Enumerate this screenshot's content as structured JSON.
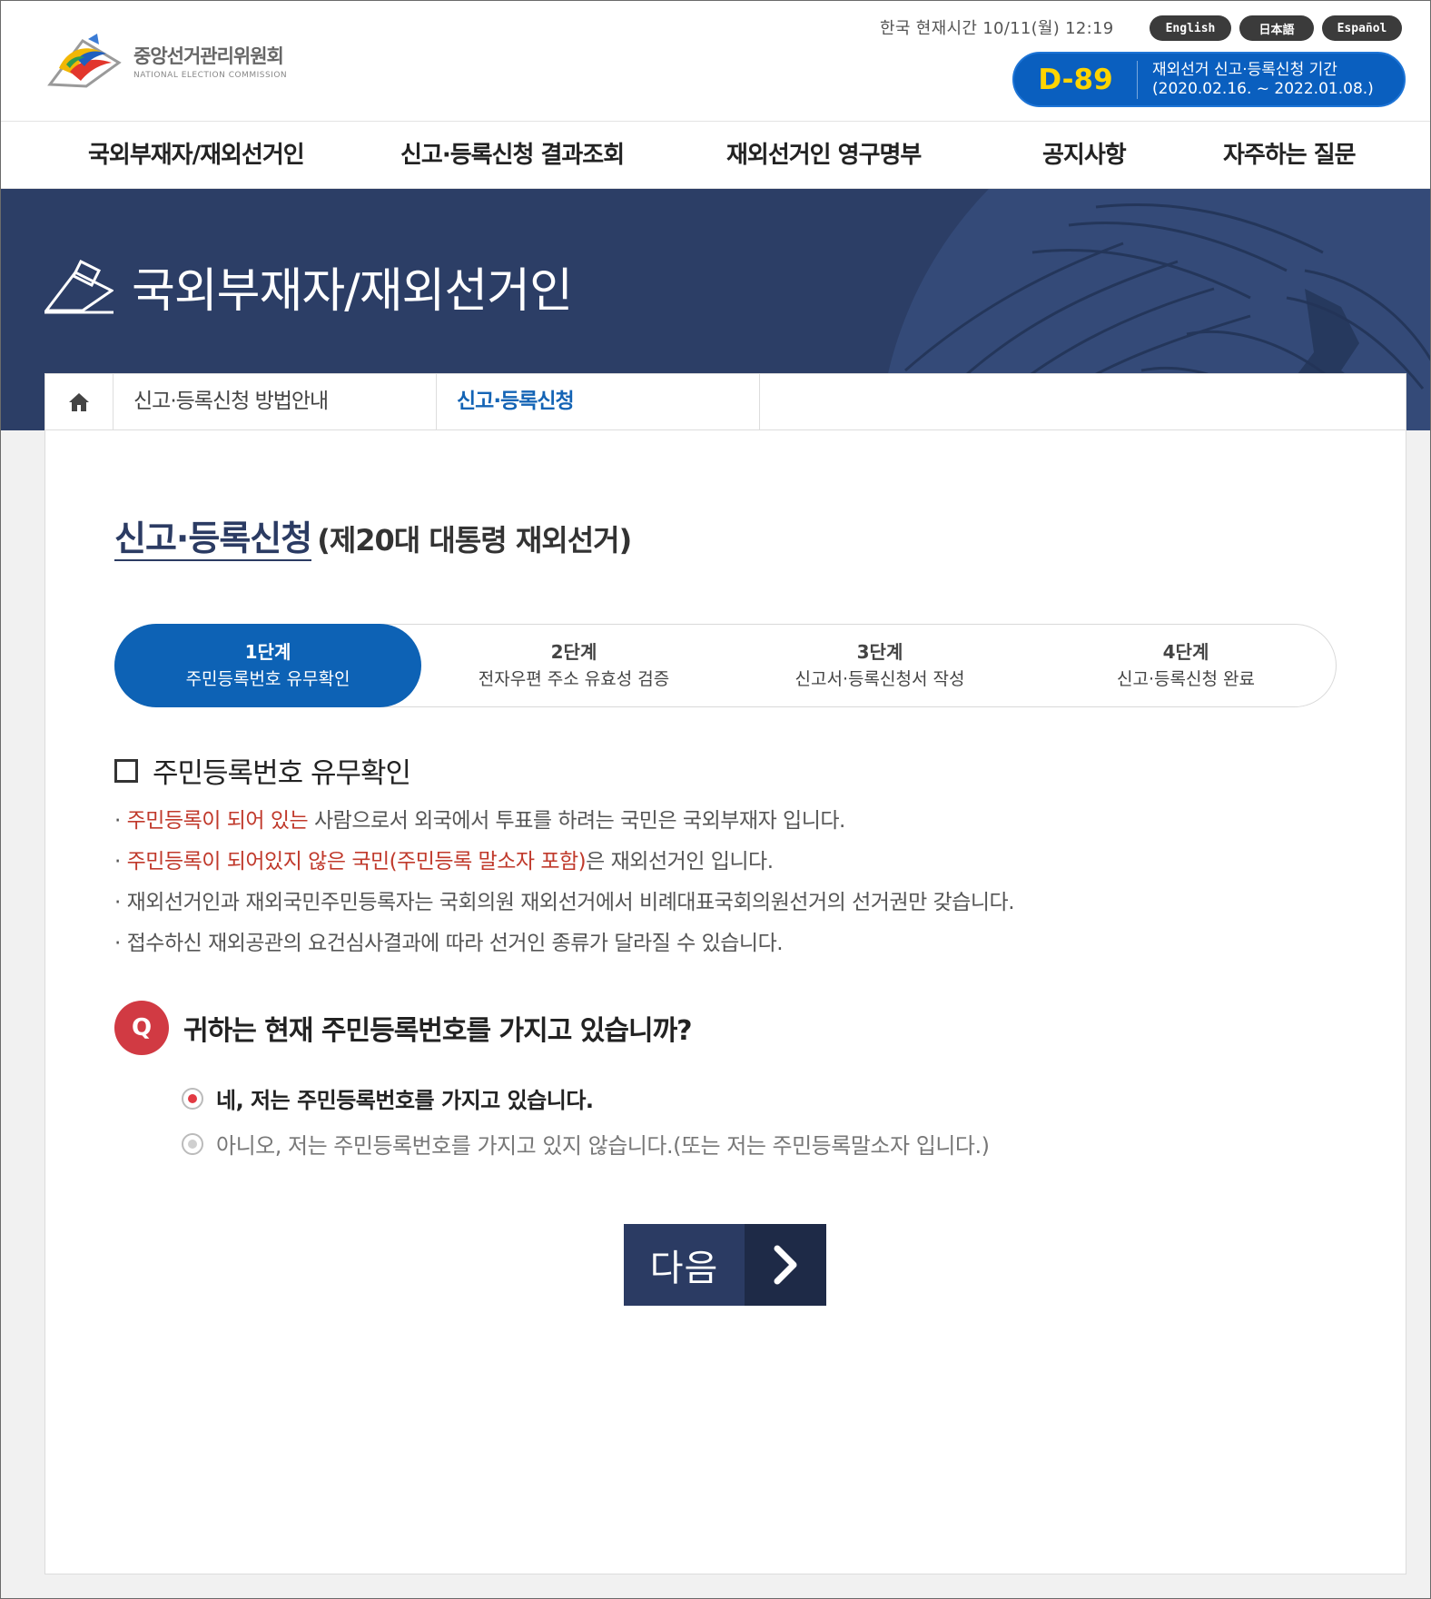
{
  "header": {
    "logo": {
      "name_ko": "중앙선거관리위원회",
      "name_en": "NATIONAL ELECTION COMMISSION"
    },
    "clock": "한국 현재시간 10/11(월) 12:19",
    "languages": [
      "English",
      "日本語",
      "Español"
    ],
    "dday": {
      "count": "D-89",
      "line1": "재외선거 신고·등록신청 기간",
      "line2": "(2020.02.16. ~ 2022.01.08.)"
    }
  },
  "gnb": [
    "국외부재자/재외선거인",
    "신고·등록신청 결과조회",
    "재외선거인 영구명부",
    "공지사항",
    "자주하는 질문"
  ],
  "banner": {
    "title": "국외부재자/재외선거인"
  },
  "subnav": {
    "tabs": [
      "신고·등록신청 방법안내",
      "신고·등록신청"
    ]
  },
  "page": {
    "heading": "신고·등록신청",
    "heading_sub": "(제20대 대통령 재외선거)"
  },
  "steps": [
    {
      "num": "1단계",
      "label": "주민등록번호 유무확인"
    },
    {
      "num": "2단계",
      "label": "전자우편 주소 유효성 검증"
    },
    {
      "num": "3단계",
      "label": "신고서·등록신청서 작성"
    },
    {
      "num": "4단계",
      "label": "신고·등록신청 완료"
    }
  ],
  "section": {
    "title": "주민등록번호 유무확인",
    "notes": [
      {
        "bullet": "· ",
        "red": "주민등록이 되어 있는",
        "rest": " 사람으로서 외국에서 투표를 하려는 국민은 국외부재자 입니다."
      },
      {
        "bullet": "· ",
        "red": "주민등록이 되어있지 않은 국민(주민등록 말소자 포함)",
        "rest": "은 재외선거인 입니다."
      },
      {
        "bullet": "· ",
        "red": "",
        "rest": "재외선거인과 재외국민주민등록자는 국회의원 재외선거에서 비례대표국회의원선거의 선거권만 갖습니다."
      },
      {
        "bullet": "· ",
        "red": "",
        "rest": "접수하신 재외공관의 요건심사결과에 따라 선거인 종류가 달라질 수 있습니다."
      }
    ]
  },
  "question": {
    "badge": "Q",
    "text": "귀하는 현재 주민등록번호를 가지고 있습니까?",
    "options": [
      {
        "label": "네, 저는 주민등록번호를 가지고 있습니다.",
        "selected": true
      },
      {
        "label": "아니오, 저는 주민등록번호를 가지고 있지 않습니다.(또는 저는 주민등록말소자 입니다.)",
        "selected": false
      }
    ]
  },
  "next_button": {
    "label": "다음"
  },
  "colors": {
    "primary_blue": "#0d62b5",
    "navy": "#2b3b63",
    "accent_red": "#d13a43",
    "dday_yellow": "#ffd400"
  }
}
